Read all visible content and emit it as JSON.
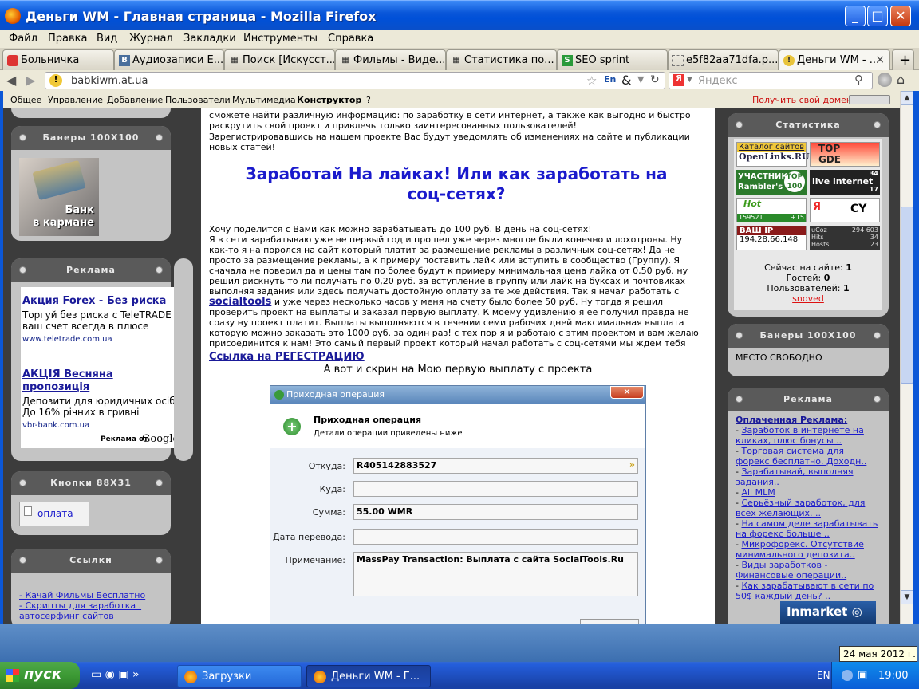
{
  "window": {
    "title": "Деньги WM - Главная страница - Mozilla Firefox"
  },
  "menu": [
    "Файл",
    "Правка",
    "Вид",
    "Журнал",
    "Закладки",
    "Инструменты",
    "Справка"
  ],
  "tabs": [
    {
      "label": "Больничка",
      "icon": "red"
    },
    {
      "label": "Аудиозаписи Е...",
      "icon": "vk"
    },
    {
      "label": "Поиск [Искусст...",
      "icon": "film"
    },
    {
      "label": "Фильмы - Виде...",
      "icon": "film"
    },
    {
      "label": "Статистика по...",
      "icon": "film"
    },
    {
      "label": "SEO sprint",
      "icon": "seo"
    },
    {
      "label": "e5f82aa71dfa.p...",
      "icon": "blank"
    },
    {
      "label": "Деньги WM - ...",
      "icon": "wm"
    }
  ],
  "nav": {
    "url": "babkiwm.at.ua",
    "search_placeholder": "Яндекс"
  },
  "bookmarks": {
    "items": [
      "Общее",
      "Управление",
      "Добавление",
      "Пользователи",
      "Мультимедиа",
      "Конструктор",
      "?"
    ],
    "domain_link": "Получить свой домен"
  },
  "left": {
    "banners_title": "Банеры 100X100",
    "banner_text_1": "Банк",
    "banner_text_2": "в кармане",
    "ads_title": "Реклама",
    "ad1": {
      "title": "Акция Forex - Без риска",
      "body": "Торгуй без риска с TeleTRADE ваш счет всегда в плюсе",
      "url": "www.teletrade.com.ua"
    },
    "ad2": {
      "title": "АКЦІЯ Весняна пропозиція",
      "body": "Депозити для юридичних осіб До 16% річних в гривні",
      "url": "vbr-bank.com.ua"
    },
    "ads_by": "Реклама от",
    "google": "Google",
    "buttons_title": "Кнопки 88X31",
    "pay_label": "оплата",
    "links_title": "Ссылки",
    "links": [
      "- Качай Фильмы Бесплатно",
      "- Скрипты для заработка .",
      "автосерфинг сайтов"
    ]
  },
  "main": {
    "intro": "сможете найти различную информацию: по заработку в сети интернет, а также как выгодно и быстро раскрутить свой проект и привлечь только заинтересованных пользователей!",
    "intro2": "Зарегистрировавшись на нашем проекте Вас будут уведомлять об изменениях на сайте и публикации новых статей!",
    "heading": "Заработай На лайках! Или как заработать на соц-сетях?",
    "p1": "Хочу поделится с Вами как можно зарабатывать до 100 руб. В день на соц-сетях!",
    "p2": "Я в сети зарабатываю уже не первый год и прошел уже через многое были конечно и лохотроны. Ну как-то я на поролся на сайт который платит за размещение рекламы в различных соц-сетях! Да не просто за размещение рекламы, а к примеру поставить лайк или вступить в сообщество (Группу). Я сначала не поверил да и цены там по более будут к примеру минимальная цена лайка от 0,50 руб. ну решил рискнуть то ли получать по 0,20 руб. за вступление в группу или лайк на буксах и почтовиках выполняя задания или здесь получать достойную оплату за те же действия. Так я начал работать с",
    "socialtools": "socialtools",
    "p3": "и уже через несколько часов у меня на счету было более 50 руб. Ну тогда я решил проверить проект на выплаты и заказал первую выплату. К моему удивлению я ее получил правда не сразу ну проект платит. Выплаты выполняются в течении семи рабочих дней максимальная выплата которую можно заказать это 1000 руб. за один раз! с тех пор я и работаю с этим проектом и вам желаю присоединится к нам! Это самый первый проект который начал работать с соц-сетями мы ждем тебя",
    "reg_link": "Ссылка на РЕГЕСТРАЦИЮ",
    "screen_caption": "А вот и скрин на Мою первую выплату с проекта"
  },
  "dialog": {
    "title": "Приходная операция",
    "heading": "Приходная операция",
    "sub": "Детали операции приведены ниже",
    "from_label": "Откуда:",
    "from_value": "R405142883527",
    "to_label": "Куда:",
    "sum_label": "Сумма:",
    "sum_value": "55.00 WMR",
    "date_label": "Дата перевода:",
    "note_label": "Примечание:",
    "note_value": "MassPay Transaction: Выплата с сайта SocialTools.Ru"
  },
  "right": {
    "stats_title": "Статистика",
    "counters": {
      "catalog": "Каталог сайтов",
      "openlinks": "OpenLinks.RU",
      "top": "TOP",
      "gde": "GDE",
      "rambler1": "УЧАСТНИК",
      "rambler2": "Rambler's",
      "top100": "TOP 100",
      "li": "live internet",
      "li_n1": "34",
      "li_n2": "17",
      "hotlog": "Hot",
      "hotlog_n": "159521",
      "hotlog_p": "+15",
      "ya": "Я",
      "cy": "CY",
      "ip_label": "ВАШ IP",
      "ip": "194.28.66.148",
      "ucoz": "uCoz",
      "ucoz_n": "294 603",
      "hits": "Hits",
      "hits_n": "34",
      "hosts": "Hosts",
      "hosts_n": "23"
    },
    "online_label": "Сейчас на сайте:",
    "online": "1",
    "guests_label": "Гостей:",
    "guests": "0",
    "users_label": "Пользователей:",
    "users": "1",
    "user_name": "snoved",
    "banners_title": "Банеры 100X100",
    "free": "МЕСТО СВОБОДНО",
    "ads_title": "Реклама",
    "paid": "Оплаченная Реклама:",
    "ads": [
      "Заработок в интернете на кликах, плюс бонусы ..",
      "Торговая система для форекс бесплатно. Доходн..",
      "Зарабатывай, выполняя задания..",
      "All MLM",
      "Серьёзный заработок, для всех желающих. ..",
      "На самом деле зарабатывать на форекс больше ..",
      "Микрофорекс. Отсутствие минимального депозита..",
      "Виды заработков - Финансовые операции..",
      "Как зарабатывают в сети по 50$ каждый день? .."
    ],
    "inmarket": "Inmarket"
  },
  "taskbar": {
    "start": "пуск",
    "tasks": [
      "Загрузки",
      "Деньги WM - Г..."
    ],
    "lang": "EN",
    "time": "19:00",
    "date_tip": "24 мая 2012 г."
  },
  "colors": {
    "titlebar": "#0a57d9",
    "heading": "#1a1acc",
    "link": "#1b1bcc",
    "boxHeader": "#5a5a5a"
  }
}
